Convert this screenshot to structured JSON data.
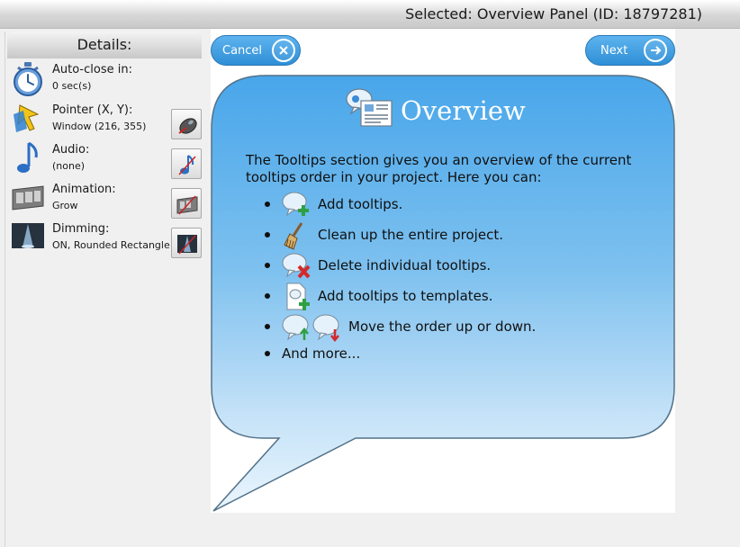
{
  "header": {
    "title": "Selected: Overview Panel (ID: 18797281)"
  },
  "details": {
    "heading": "Details:",
    "items": [
      {
        "label": "Auto-close in:",
        "value": "0 sec(s)",
        "icon": "stopwatch-icon"
      },
      {
        "label": "Pointer (X, Y):",
        "value": "Window (216, 355)",
        "icon": "pointer-icon"
      },
      {
        "label": "Audio:",
        "value": "(none)",
        "icon": "music-note-icon"
      },
      {
        "label": "Animation:",
        "value": "Grow",
        "icon": "film-strip-icon"
      },
      {
        "label": "Dimming:",
        "value": "ON, Rounded Rectangle",
        "icon": "spotlight-icon"
      }
    ]
  },
  "nav": {
    "cancel_label": "Cancel",
    "next_label": "Next"
  },
  "tooltip": {
    "title": "Overview",
    "intro": "The Tooltips section gives you an overview of the current tooltips order in your project. Here you can:",
    "bullets": [
      {
        "text": "Add tooltips.",
        "icons": [
          "add-tooltip-icon"
        ]
      },
      {
        "text": "Clean up the entire project.",
        "icons": [
          "broom-icon"
        ]
      },
      {
        "text": "Delete individual tooltips.",
        "icons": [
          "delete-tooltip-icon"
        ]
      },
      {
        "text": "Add tooltips to templates.",
        "icons": [
          "add-template-icon"
        ]
      },
      {
        "text": "Move the order up or down.",
        "icons": [
          "move-up-icon",
          "move-down-icon"
        ]
      },
      {
        "text": "And more...",
        "icons": []
      }
    ]
  },
  "colors": {
    "accent": "#2f8fd6",
    "bubble_top": "#49a7ea",
    "bubble_bottom": "#e2f1fc"
  }
}
